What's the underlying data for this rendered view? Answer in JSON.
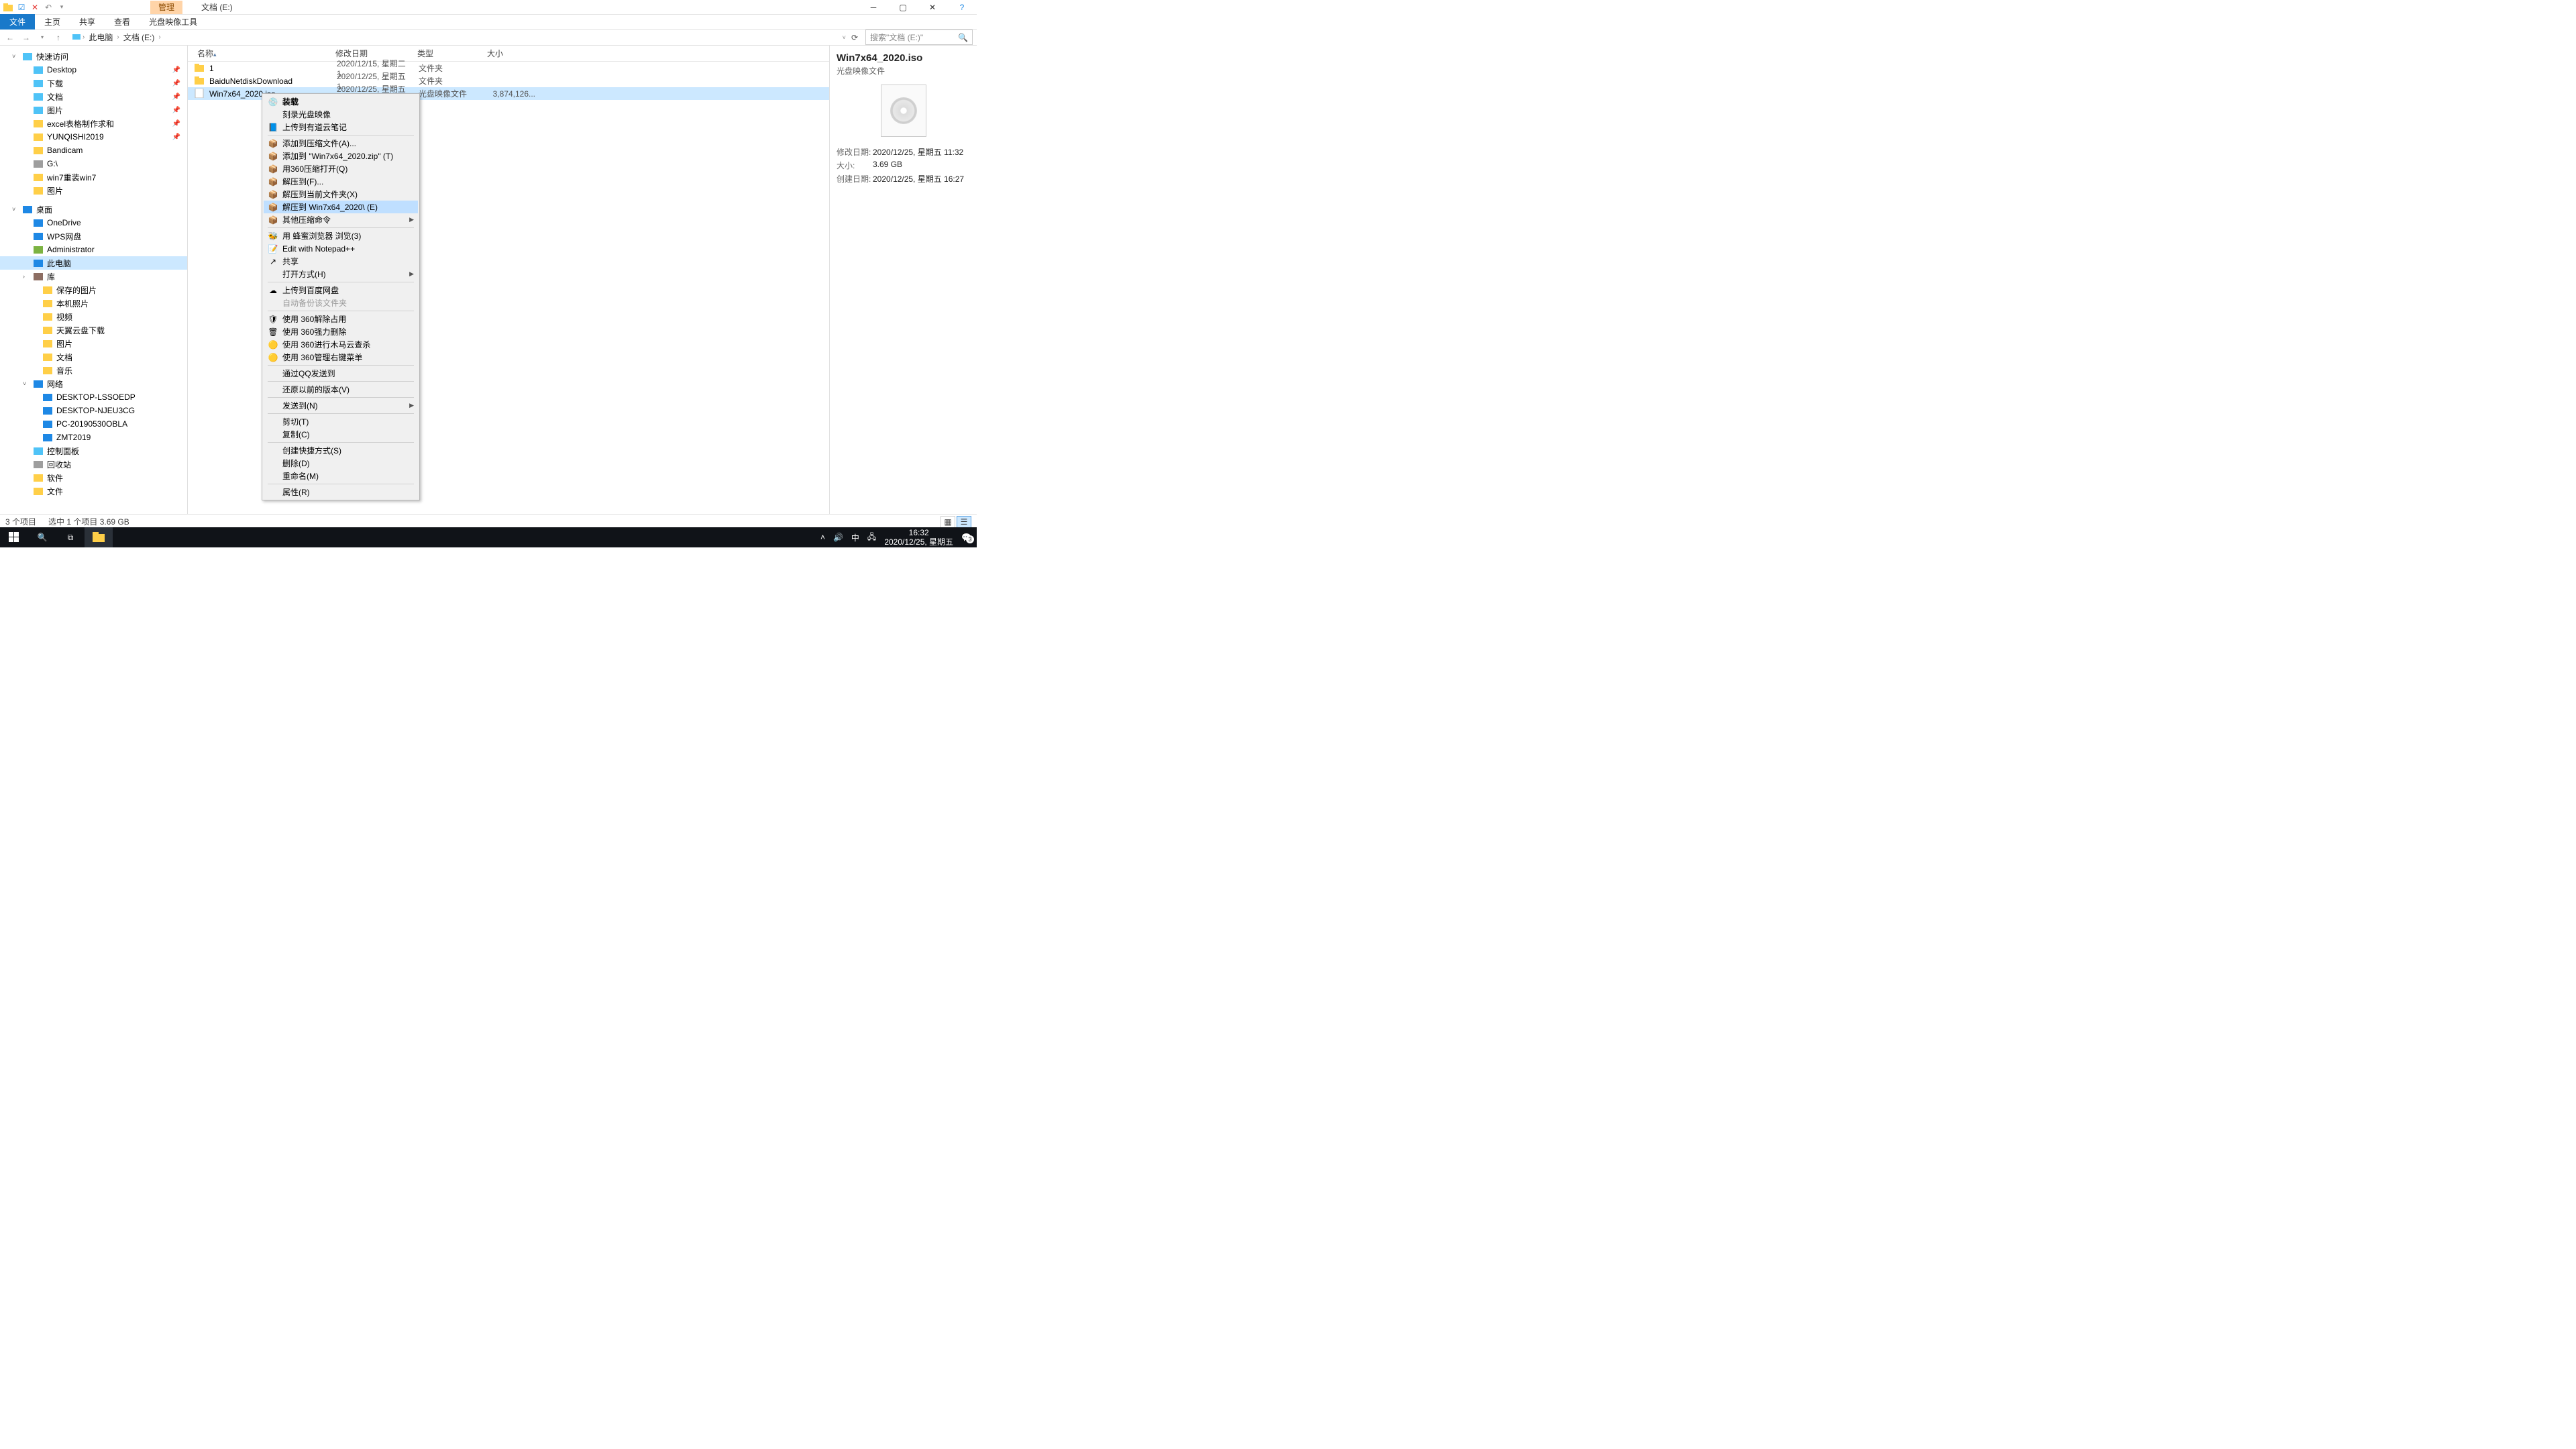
{
  "titlebar": {
    "context_tab": "管理",
    "title": "文档 (E:)"
  },
  "ribbon": {
    "tabs": [
      "文件",
      "主页",
      "共享",
      "查看"
    ],
    "context_tool": "光盘映像工具"
  },
  "breadcrumb": [
    "此电脑",
    "文档 (E:)"
  ],
  "search_placeholder": "搜索\"文档 (E:)\"",
  "columns": {
    "name": "名称",
    "date": "修改日期",
    "type": "类型",
    "size": "大小"
  },
  "nav": [
    {
      "l": 1,
      "exp": "v",
      "icon": "star",
      "color": "#4fc3f7",
      "label": "快速访问"
    },
    {
      "l": 2,
      "icon": "folder",
      "color": "#4fc3f7",
      "label": "Desktop",
      "pin": true
    },
    {
      "l": 2,
      "icon": "folder",
      "color": "#4fc3f7",
      "label": "下载",
      "pin": true
    },
    {
      "l": 2,
      "icon": "folder",
      "color": "#4fc3f7",
      "label": "文档",
      "pin": true
    },
    {
      "l": 2,
      "icon": "folder",
      "color": "#4fc3f7",
      "label": "图片",
      "pin": true
    },
    {
      "l": 2,
      "icon": "folder",
      "color": "#ffcf48",
      "label": "excel表格制作求和",
      "pin": true
    },
    {
      "l": 2,
      "icon": "folder",
      "color": "#ffcf48",
      "label": "YUNQISHI2019",
      "pin": true
    },
    {
      "l": 2,
      "icon": "folder",
      "color": "#ffcf48",
      "label": "Bandicam"
    },
    {
      "l": 2,
      "icon": "drive",
      "color": "#9e9e9e",
      "label": "G:\\"
    },
    {
      "l": 2,
      "icon": "folder",
      "color": "#ffcf48",
      "label": "win7重装win7"
    },
    {
      "l": 2,
      "icon": "folder",
      "color": "#ffcf48",
      "label": "图片"
    },
    {
      "l": 1,
      "exp": "v",
      "icon": "desktop",
      "color": "#1e88e5",
      "label": "桌面",
      "spacer": true
    },
    {
      "l": 2,
      "icon": "cloud",
      "color": "#1e88e5",
      "label": "OneDrive"
    },
    {
      "l": 2,
      "icon": "cloud",
      "color": "#1e88e5",
      "label": "WPS网盘"
    },
    {
      "l": 2,
      "icon": "user",
      "color": "#7cb342",
      "label": "Administrator"
    },
    {
      "l": 2,
      "icon": "pc",
      "color": "#1e88e5",
      "label": "此电脑",
      "selected": true
    },
    {
      "l": 2,
      "exp": ">",
      "icon": "lib",
      "color": "#8d6e63",
      "label": "库"
    },
    {
      "l": 2,
      "icon": "folder",
      "color": "#ffcf48",
      "label": "保存的图片",
      "indent": 3
    },
    {
      "l": 2,
      "icon": "folder",
      "color": "#ffcf48",
      "label": "本机照片",
      "indent": 3
    },
    {
      "l": 2,
      "icon": "folder",
      "color": "#ffcf48",
      "label": "视频",
      "indent": 3
    },
    {
      "l": 2,
      "icon": "folder",
      "color": "#ffcf48",
      "label": "天翼云盘下载",
      "indent": 3
    },
    {
      "l": 2,
      "icon": "folder",
      "color": "#ffcf48",
      "label": "图片",
      "indent": 3
    },
    {
      "l": 2,
      "icon": "folder",
      "color": "#ffcf48",
      "label": "文档",
      "indent": 3
    },
    {
      "l": 2,
      "icon": "folder",
      "color": "#ffcf48",
      "label": "音乐",
      "indent": 3
    },
    {
      "l": 2,
      "exp": "v",
      "icon": "net",
      "color": "#1e88e5",
      "label": "网络"
    },
    {
      "l": 2,
      "icon": "pc",
      "color": "#1e88e5",
      "label": "DESKTOP-LSSOEDP",
      "indent": 3
    },
    {
      "l": 2,
      "icon": "pc",
      "color": "#1e88e5",
      "label": "DESKTOP-NJEU3CG",
      "indent": 3
    },
    {
      "l": 2,
      "icon": "pc",
      "color": "#1e88e5",
      "label": "PC-20190530OBLA",
      "indent": 3
    },
    {
      "l": 2,
      "icon": "pc",
      "color": "#1e88e5",
      "label": "ZMT2019",
      "indent": 3
    },
    {
      "l": 2,
      "icon": "panel",
      "color": "#4fc3f7",
      "label": "控制面板"
    },
    {
      "l": 2,
      "icon": "bin",
      "color": "#9e9e9e",
      "label": "回收站"
    },
    {
      "l": 2,
      "icon": "folder",
      "color": "#ffcf48",
      "label": "软件"
    },
    {
      "l": 2,
      "icon": "folder",
      "color": "#ffcf48",
      "label": "文件"
    }
  ],
  "files": [
    {
      "name": "1",
      "date": "2020/12/15, 星期二 1...",
      "type": "文件夹",
      "size": "",
      "icon": "folder"
    },
    {
      "name": "BaiduNetdiskDownload",
      "date": "2020/12/25, 星期五 1...",
      "type": "文件夹",
      "size": "",
      "icon": "folder"
    },
    {
      "name": "Win7x64_2020.iso",
      "date": "2020/12/25, 星期五 1...",
      "type": "光盘映像文件",
      "size": "3,874,126...",
      "icon": "disc",
      "selected": true
    }
  ],
  "details": {
    "name": "Win7x64_2020.iso",
    "type": "光盘映像文件",
    "props": [
      {
        "k": "修改日期:",
        "v": "2020/12/25, 星期五 11:32"
      },
      {
        "k": "大小:",
        "v": "3.69 GB"
      },
      {
        "k": "创建日期:",
        "v": "2020/12/25, 星期五 16:27"
      }
    ]
  },
  "status": {
    "count": "3 个项目",
    "selection": "选中 1 个项目  3.69 GB"
  },
  "context_menu": [
    {
      "icon": "disc-mount",
      "label": "装载",
      "bold": true
    },
    {
      "label": "刻录光盘映像"
    },
    {
      "icon": "note-blue",
      "label": "上传到有道云笔记"
    },
    {
      "sep": true
    },
    {
      "icon": "zip",
      "label": "添加到压缩文件(A)..."
    },
    {
      "icon": "zip",
      "label": "添加到 \"Win7x64_2020.zip\" (T)"
    },
    {
      "icon": "zip",
      "label": "用360压缩打开(Q)"
    },
    {
      "icon": "zip",
      "label": "解压到(F)..."
    },
    {
      "icon": "zip",
      "label": "解压到当前文件夹(X)"
    },
    {
      "icon": "zip",
      "label": "解压到 Win7x64_2020\\ (E)",
      "hover": true
    },
    {
      "icon": "zip",
      "label": "其他压缩命令",
      "sub": true
    },
    {
      "sep": true
    },
    {
      "icon": "bee",
      "label": "用 蜂蜜浏览器 浏览(3)"
    },
    {
      "icon": "npp",
      "label": "Edit with Notepad++"
    },
    {
      "icon": "share",
      "label": "共享"
    },
    {
      "label": "打开方式(H)",
      "sub": true
    },
    {
      "sep": true
    },
    {
      "icon": "baidu",
      "label": "上传到百度网盘"
    },
    {
      "label": "自动备份该文件夹",
      "disabled": true
    },
    {
      "sep": true
    },
    {
      "icon": "360",
      "label": "使用 360解除占用"
    },
    {
      "icon": "360del",
      "label": "使用 360强力删除"
    },
    {
      "icon": "360y",
      "label": "使用 360进行木马云查杀"
    },
    {
      "icon": "360y",
      "label": "使用 360管理右键菜单"
    },
    {
      "sep": true
    },
    {
      "label": "通过QQ发送到"
    },
    {
      "sep": true
    },
    {
      "label": "还原以前的版本(V)"
    },
    {
      "sep": true
    },
    {
      "label": "发送到(N)",
      "sub": true
    },
    {
      "sep": true
    },
    {
      "label": "剪切(T)"
    },
    {
      "label": "复制(C)"
    },
    {
      "sep": true
    },
    {
      "label": "创建快捷方式(S)"
    },
    {
      "label": "删除(D)"
    },
    {
      "label": "重命名(M)"
    },
    {
      "sep": true
    },
    {
      "label": "属性(R)"
    }
  ],
  "taskbar": {
    "time": "16:32",
    "date": "2020/12/25, 星期五",
    "badge": "3"
  }
}
